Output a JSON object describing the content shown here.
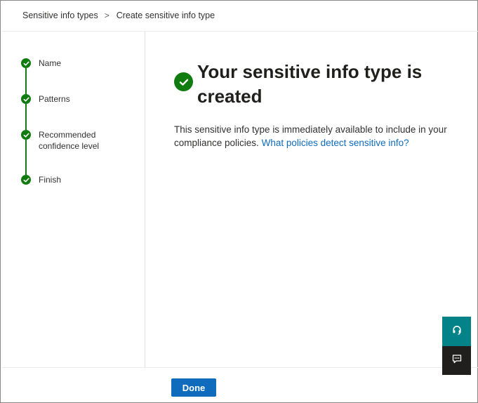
{
  "breadcrumb": {
    "items": [
      "Sensitive info types",
      "Create sensitive info type"
    ],
    "separator": ">"
  },
  "wizard": {
    "steps": [
      {
        "label": "Name",
        "status": "complete"
      },
      {
        "label": "Patterns",
        "status": "complete"
      },
      {
        "label": "Recommended confidence level",
        "status": "complete"
      },
      {
        "label": "Finish",
        "status": "complete"
      }
    ]
  },
  "content": {
    "title": "Your sensitive info type is created",
    "description": "This sensitive info type is immediately available to include in your compliance policies.",
    "link_text": "What policies detect sensitive info?"
  },
  "footer": {
    "done_label": "Done"
  },
  "side_actions": {
    "help_icon": "headset-icon",
    "feedback_icon": "feedback-icon"
  },
  "colors": {
    "success": "#107c10",
    "primary": "#0f6cbd",
    "help_bg": "#038387",
    "feedback_bg": "#201f1e"
  }
}
